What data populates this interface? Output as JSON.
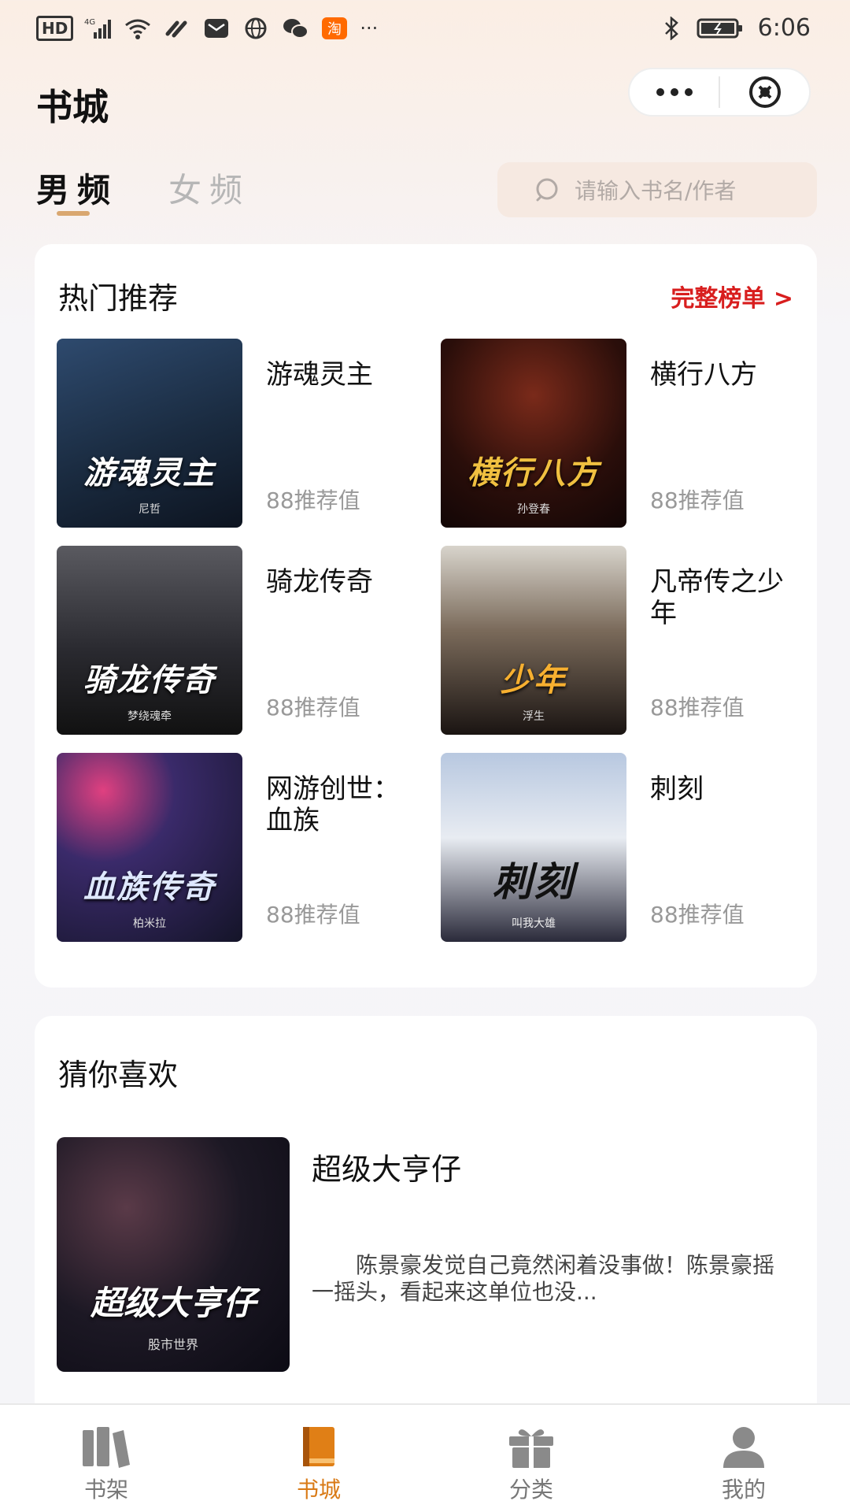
{
  "status_bar": {
    "left_icons": [
      "hd-icon",
      "signal-4g-icon",
      "wifi-icon",
      "link-icon",
      "message-icon",
      "globe-icon",
      "wechat-icon",
      "taobao-icon"
    ],
    "hd_label": "HD",
    "network_label": "4G",
    "taobao_label": "淘",
    "more": "···",
    "time": "6:06"
  },
  "header": {
    "title": "书城"
  },
  "tabs": [
    {
      "label": "男频",
      "active": true
    },
    {
      "label": "女频",
      "active": false
    }
  ],
  "search": {
    "placeholder": "请输入书名/作者"
  },
  "hot": {
    "title": "热门推荐",
    "more_label": "完整榜单 >",
    "books": [
      {
        "name": "游魂灵主",
        "score": "88推荐值",
        "cover_text": "游魂灵主",
        "cover_author": "尼哲"
      },
      {
        "name": "横行八方",
        "score": "88推荐值",
        "cover_text": "横行八方",
        "cover_author": "孙登春"
      },
      {
        "name": "骑龙传奇",
        "score": "88推荐值",
        "cover_text": "骑龙传奇",
        "cover_author": "梦绕魂牵"
      },
      {
        "name": "凡帝传之少年",
        "score": "88推荐值",
        "cover_text": "少年",
        "cover_author": "浮生"
      },
      {
        "name": "网游创世：血族",
        "score": "88推荐值",
        "cover_text": "血族传奇",
        "cover_author": "柏米拉"
      },
      {
        "name": "刺刻",
        "score": "88推荐值",
        "cover_text": "刺刻",
        "cover_author": "叫我大雄"
      }
    ]
  },
  "guess": {
    "title": "猜你喜欢",
    "book": {
      "name": "超级大亨仔",
      "cover_text": "超级大亨仔",
      "cover_author": "股市世界",
      "description": "　　陈景豪发觉自己竟然闲着没事做！陈景豪摇一摇头，看起来这单位也没..."
    }
  },
  "bottom_nav": [
    {
      "label": "书架",
      "icon": "bookshelf-icon",
      "active": false
    },
    {
      "label": "书城",
      "icon": "bookstore-icon",
      "active": true
    },
    {
      "label": "分类",
      "icon": "gift-icon",
      "active": false
    },
    {
      "label": "我的",
      "icon": "user-icon",
      "active": false
    }
  ],
  "colors": {
    "accent": "#d97a16",
    "link_red": "#d81e1e",
    "tab_underline": "#d9a770"
  }
}
